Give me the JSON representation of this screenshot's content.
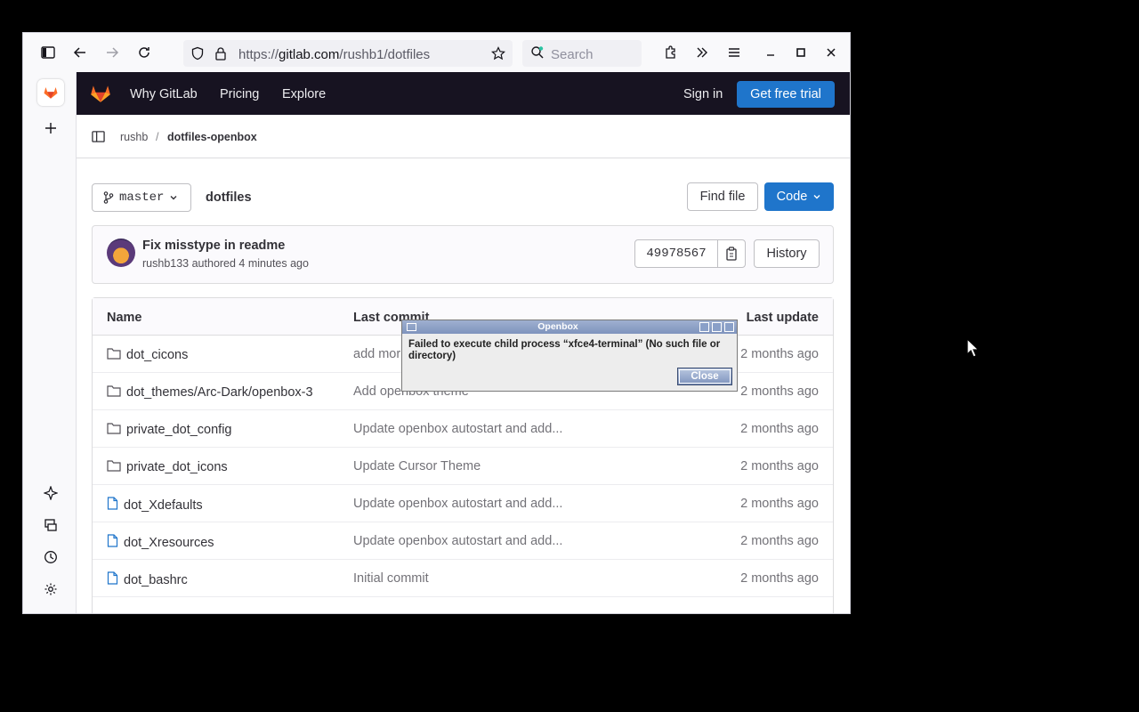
{
  "browser": {
    "url_prefix": "https://",
    "url_host": "gitlab.com",
    "url_path": "/rushb1/dotfiles",
    "search_placeholder": "Search"
  },
  "gitlab_header": {
    "nav": [
      "Why GitLab",
      "Pricing",
      "Explore"
    ],
    "sign_in": "Sign in",
    "trial": "Get free trial"
  },
  "breadcrumb": {
    "user": "rushb",
    "separator": "/",
    "project": "dotfiles-openbox"
  },
  "repo": {
    "branch": "master",
    "path": "dotfiles",
    "find_file": "Find file",
    "code": "Code"
  },
  "commit": {
    "title": "Fix misstype in readme",
    "author": "rushb133",
    "authored": "authored 4 minutes ago",
    "sha": "49978567",
    "history": "History"
  },
  "table": {
    "headers": {
      "name": "Name",
      "commit": "Last commit",
      "update": "Last update"
    },
    "rows": [
      {
        "name": "dot_cicons",
        "type": "folder",
        "commit": "add mor",
        "update": "2 months ago"
      },
      {
        "name": "dot_themes/Arc-Dark/openbox-3",
        "type": "folder",
        "commit": "Add openbox theme",
        "update": "2 months ago"
      },
      {
        "name": "private_dot_config",
        "type": "folder",
        "commit": "Update openbox autostart and add...",
        "update": "2 months ago"
      },
      {
        "name": "private_dot_icons",
        "type": "folder",
        "commit": "Update Cursor Theme",
        "update": "2 months ago"
      },
      {
        "name": "dot_Xdefaults",
        "type": "file",
        "commit": "Update openbox autostart and add...",
        "update": "2 months ago"
      },
      {
        "name": "dot_Xresources",
        "type": "file",
        "commit": "Update openbox autostart and add...",
        "update": "2 months ago"
      },
      {
        "name": "dot_bashrc",
        "type": "file",
        "commit": "Initial commit",
        "update": "2 months ago"
      }
    ]
  },
  "dialog": {
    "title": "Openbox",
    "message": "Failed to execute child process “xfce4-terminal” (No such file or directory)",
    "close": "Close"
  },
  "colors": {
    "gitlab_header_bg": "#171321",
    "primary_blue": "#1f75cb",
    "openbox_title": "#8aa0c8"
  }
}
